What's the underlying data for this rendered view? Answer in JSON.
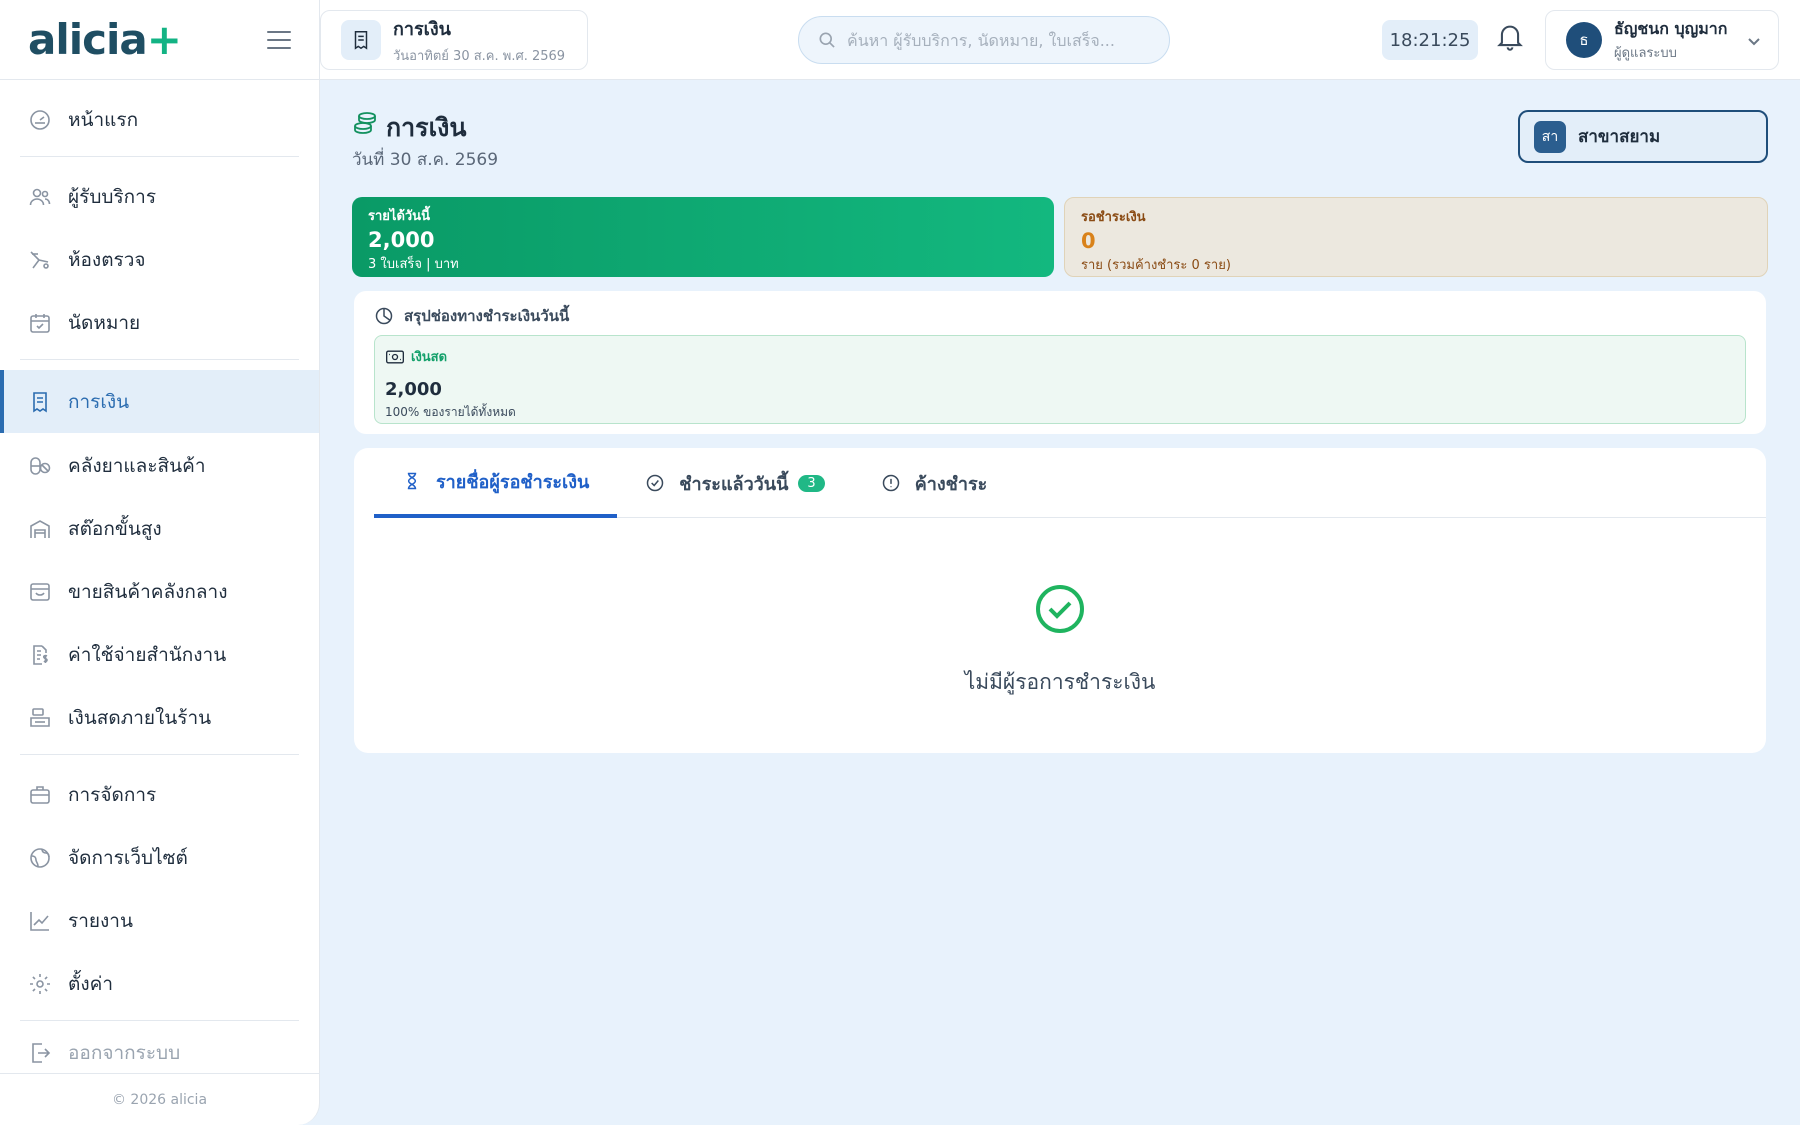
{
  "sidebar": {
    "logo": "alicia",
    "logo_plus": "+",
    "items": [
      {
        "label": "หน้าแรก"
      },
      {
        "label": "ผู้รับบริการ"
      },
      {
        "label": "ห้องตรวจ"
      },
      {
        "label": "นัดหมาย"
      },
      {
        "label": "การเงิน"
      },
      {
        "label": "คลังยาและสินค้า"
      },
      {
        "label": "สต๊อกขั้นสูง"
      },
      {
        "label": "ขายสินค้าคลังกลาง"
      },
      {
        "label": "ค่าใช้จ่ายสำนักงาน"
      },
      {
        "label": "เงินสดภายในร้าน"
      },
      {
        "label": "การจัดการ"
      },
      {
        "label": "จัดการเว็บไซต์"
      },
      {
        "label": "รายงาน"
      },
      {
        "label": "ตั้งค่า"
      },
      {
        "label": "ออกจากระบบ"
      }
    ],
    "footer": "© 2026 alicia"
  },
  "topbar": {
    "page_title": "การเงิน",
    "page_subtitle": "วันอาทิตย์ 30 ส.ค. พ.ศ. 2569",
    "search_placeholder": "ค้นหา ผู้รับบริการ, นัดหมาย, ใบเสร็จ...",
    "search_value": "",
    "clock": "18:21:25",
    "user_initial": "ธ",
    "user_name": "ธัญชนก บุญมาก",
    "user_role": "ผู้ดูแลระบบ"
  },
  "main": {
    "title": "การเงิน",
    "date": "วันที่ 30 ส.ค. 2569",
    "branch_badge": "สา",
    "branch_label": "สาขาสยาม",
    "income": {
      "label": "รายได้วันนี้",
      "value": "2,000",
      "sub": "3 ใบเสร็จ | บาท"
    },
    "pending": {
      "label": "รอชำระเงิน",
      "value": "0",
      "sub": "ราย (รวมค้างชำระ 0 ราย)"
    },
    "summary_title": "สรุปช่องทางชำระเงินวันนี้",
    "cash": {
      "label": "เงินสด",
      "value": "2,000",
      "sub": "100% ของรายได้ทั้งหมด"
    },
    "tabs": [
      {
        "label": "รายชื่อผู้รอชำระเงิน"
      },
      {
        "label": "ชำระแล้ววันนี้",
        "count": "3"
      },
      {
        "label": "ค้างชำระ"
      }
    ],
    "empty_text": "ไม่มีผู้รอการชำระเงิน"
  },
  "colors": {
    "accent": "#2060c8",
    "income_green": "#0a9a66",
    "pending_bg": "#ece8df",
    "pending_value": "#d9821a",
    "success": "#1fb45f"
  },
  "icons": [
    "gauge-icon",
    "users-icon",
    "stethoscope-icon",
    "calendar-icon",
    "receipt-icon",
    "pills-icon",
    "warehouse-icon",
    "store-icon",
    "expense-icon",
    "cash-register-icon",
    "briefcase-icon",
    "globe-icon",
    "chart-icon",
    "gear-icon",
    "logout-icon",
    "search-icon",
    "bell-icon",
    "coins-icon",
    "pie-icon",
    "banknote-icon",
    "hourglass-icon",
    "check-circle-icon",
    "alert-circle-icon"
  ]
}
